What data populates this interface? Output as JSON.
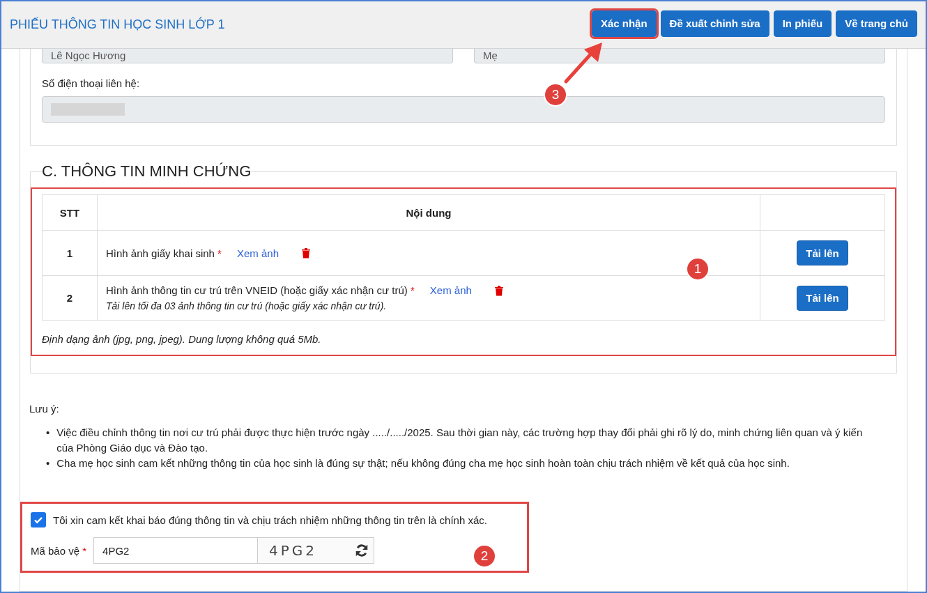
{
  "header": {
    "title": "PHIẾU THÔNG TIN HỌC SINH LỚP 1",
    "buttons": [
      {
        "label": "Xác nhận",
        "highlighted": true
      },
      {
        "label": "Đề xuất chỉnh sửa",
        "highlighted": false
      },
      {
        "label": "In phiếu",
        "highlighted": false
      },
      {
        "label": "Về trang chủ",
        "highlighted": false
      }
    ]
  },
  "guardian": {
    "fields": [
      {
        "value": "Lê Ngọc Hương"
      },
      {
        "value": "Mẹ"
      }
    ],
    "phone": {
      "label": "Số điện thoại liên hệ:",
      "redacted": true
    }
  },
  "evidence": {
    "title": "C. THÔNG TIN MINH CHỨNG",
    "columns": [
      "STT",
      "Nội dung"
    ],
    "rows": [
      {
        "stt": "1",
        "label": "Hình ảnh giấy khai sinh",
        "required_mark": "*",
        "view_link": "Xem ảnh",
        "hint": "",
        "upload": "Tải lên"
      },
      {
        "stt": "2",
        "label": "Hình ảnh thông tin cư trú trên VNEID (hoặc giấy xác nhận cư trú)",
        "required_mark": "*",
        "view_link": "Xem ảnh",
        "hint": "Tải lên tối đa 03 ảnh thông tin cư trú (hoặc giấy xác nhận cư trú).",
        "upload": "Tải lên"
      }
    ],
    "footnote": "Định dạng ảnh (jpg, png, jpeg). Dung lượng không quá 5Mb."
  },
  "notes": {
    "title": "Lưu ý:",
    "bullet": "•",
    "items": [
      "Việc điều chỉnh thông tin nơi cư trú phải được thực hiện trước ngày ...../...../2025. Sau thời gian này, các trường hợp thay đổi phải ghi rõ lý do, minh chứng liên quan và ý kiến của Phòng Giáo dục và Đào tạo.",
      "Cha mẹ học sinh cam kết những thông tin của học sinh là đúng sự thật; nếu không đúng cha mẹ học sinh hoàn toàn chịu trách nhiệm về kết quả của học sinh."
    ]
  },
  "commitment": {
    "checked": true,
    "text": "Tôi xin cam kết khai báo đúng thông tin và chịu trách nhiệm những thông tin trên là chính xác."
  },
  "captcha": {
    "label": "Mã bảo vệ",
    "required_mark": "*",
    "value": "4PG2",
    "image_text": "4PG2"
  },
  "annotations": [
    {
      "number": "1"
    },
    {
      "number": "2"
    },
    {
      "number": "3"
    }
  ]
}
